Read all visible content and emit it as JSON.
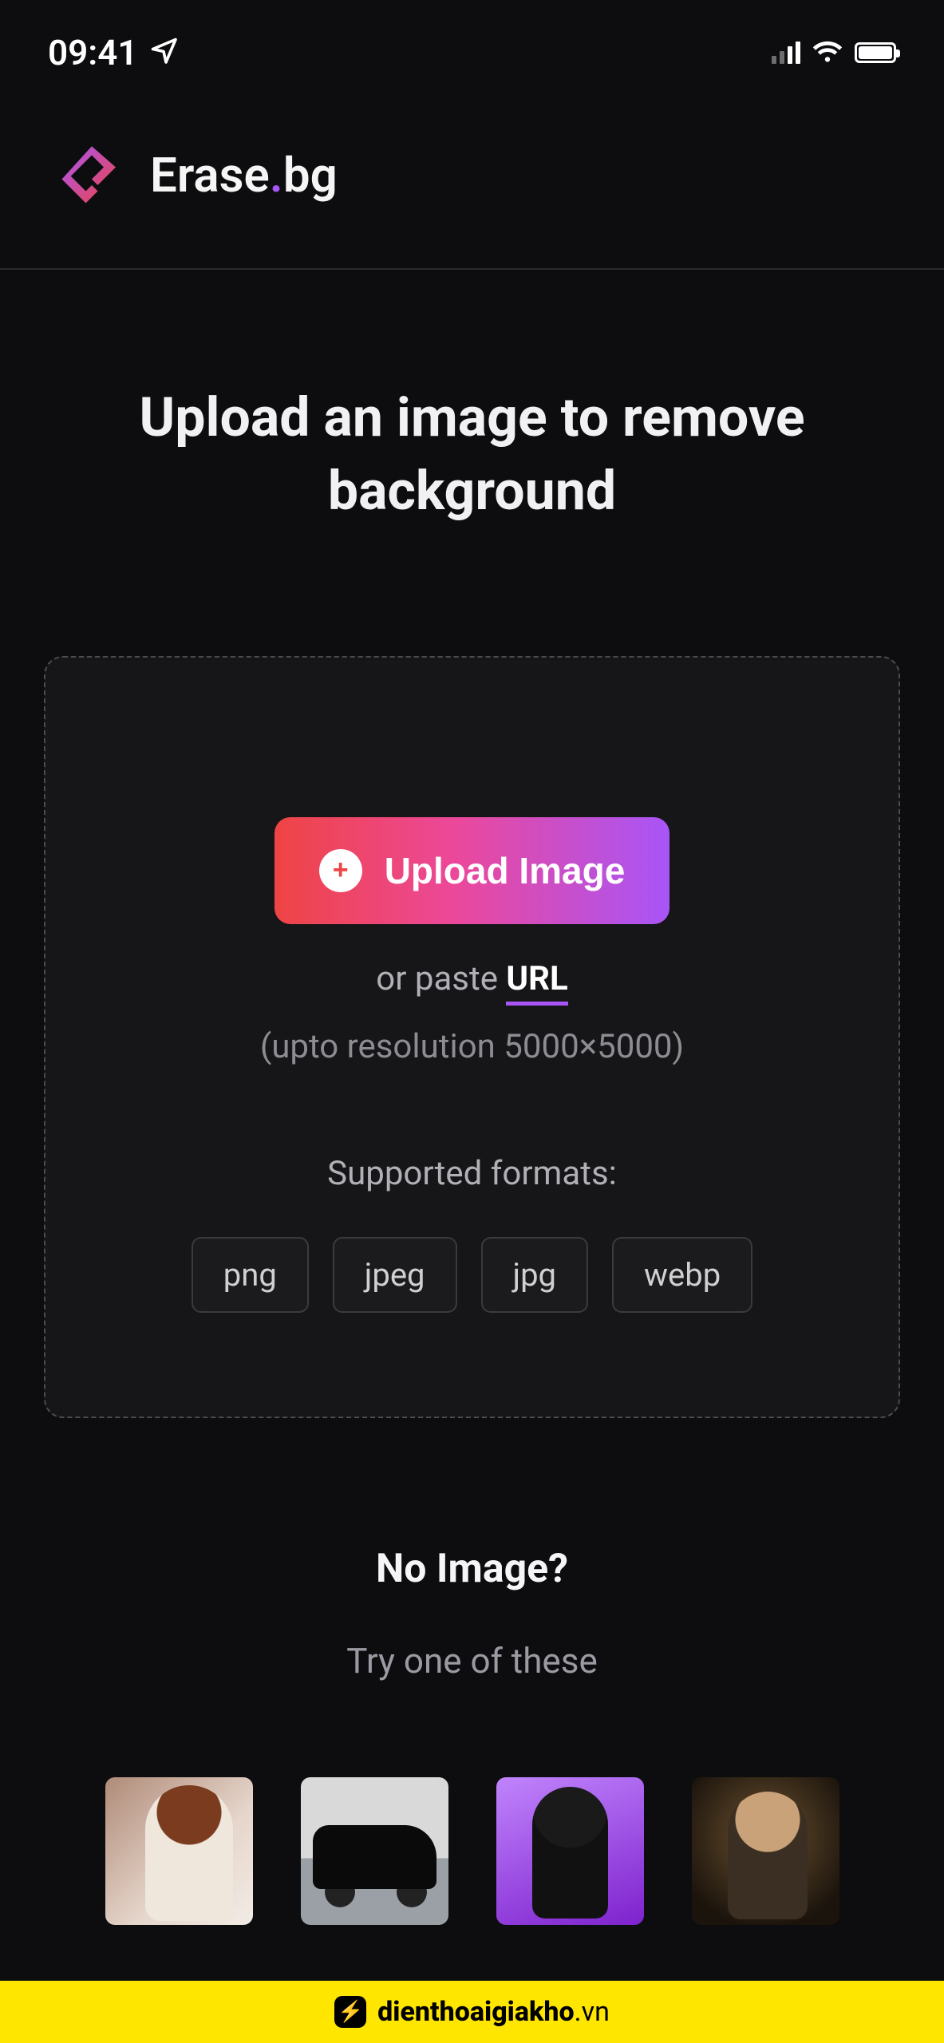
{
  "status": {
    "time": "09:41"
  },
  "brand": {
    "name_pre": "Erase",
    "name_post": "bg"
  },
  "hero": {
    "title": "Upload an image to remove background"
  },
  "dropzone": {
    "upload_label": "Upload Image",
    "paste_pre": "or paste ",
    "url_label": "URL",
    "resolution_note": "(upto resolution 5000×5000)",
    "formats_label": "Supported formats:",
    "formats": [
      "png",
      "jpeg",
      "jpg",
      "webp"
    ]
  },
  "noimage": {
    "title": "No Image?",
    "subtitle": "Try one of these"
  },
  "samples": [
    {
      "name": "sample-person-1"
    },
    {
      "name": "sample-car"
    },
    {
      "name": "sample-person-2"
    },
    {
      "name": "sample-person-3"
    }
  ],
  "banner": {
    "text_main": "dienthoaigiakho",
    "text_suffix": ".vn"
  }
}
